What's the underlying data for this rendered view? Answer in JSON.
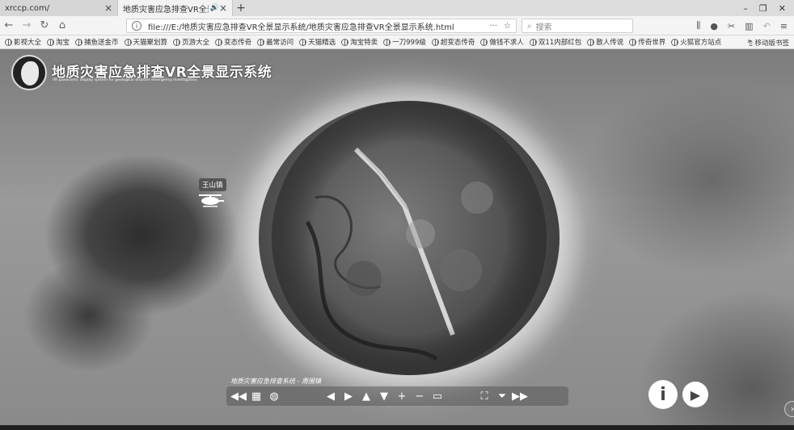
{
  "browser": {
    "tabs": [
      {
        "title": "xrccp.com/",
        "active": false
      },
      {
        "title": "地质灾害应急排查VR全景显示系",
        "active": true
      }
    ],
    "new_tab_label": "+",
    "window_controls": [
      "–",
      "❐",
      "✕"
    ],
    "url": "file:///E:/地质灾害应急排查VR全景显示系统/地质灾害应急排查VR全景显示系统.html",
    "url_more": "···",
    "search_placeholder": "搜索",
    "bookmarks": [
      "影视大全",
      "淘宝",
      "捕鱼送金币",
      "天猫聚划算",
      "页游大全",
      "变态传奇",
      "最常访问",
      "天猫精选",
      "淘宝特卖",
      "一刀999级",
      "超变态传奇",
      "做钱不求人",
      "双11内部红包",
      "散人传说",
      "传奇世界",
      "火狐官方站点"
    ],
    "bookmarks_more": "»",
    "mobile_bookmarks": "移动版书签"
  },
  "viewer": {
    "title": "地质灾害应急排查VR全景显示系统",
    "subtitle": "VR panoramic display system for geological disaster emergency investigation",
    "hotspot_label": "王山镇",
    "scene_caption": "地质灾害应急排查系统 - 周围镇",
    "toolbar_icons": [
      "rewind-icon",
      "grid-icon",
      "globe-icon",
      "arrow-left-icon",
      "arrow-right-icon",
      "arrow-up-icon",
      "arrow-down-icon",
      "plus-icon",
      "minus-icon",
      "vr-glasses-icon",
      "fullscreen-icon",
      "hide-icon",
      "fast-forward-icon"
    ],
    "info_button": "i",
    "play_button": "▶"
  }
}
